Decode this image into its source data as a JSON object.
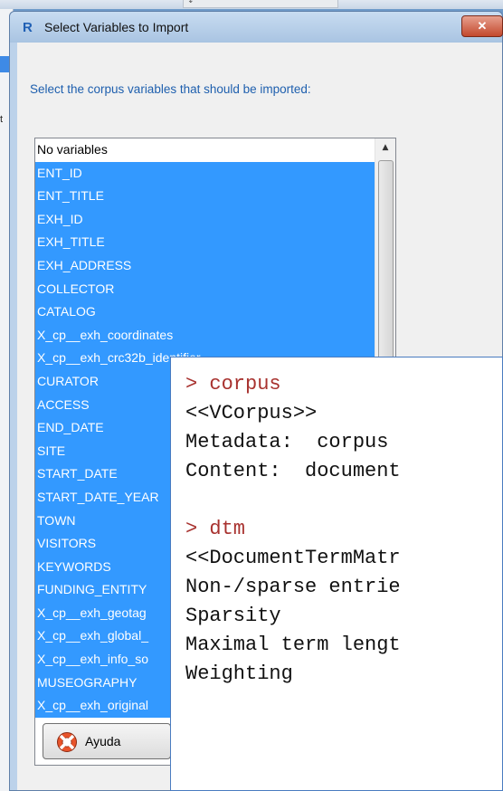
{
  "background": {
    "side_text": "t",
    "handle_text": "↓"
  },
  "dialog": {
    "app_icon_text": "R",
    "title": "Select Variables to Import",
    "close_symbol": "✕",
    "instruction": "Select the corpus variables that should be imported:",
    "list_items": [
      {
        "label": "No variables",
        "selected": false
      },
      {
        "label": "ENT_ID",
        "selected": true
      },
      {
        "label": "ENT_TITLE",
        "selected": true
      },
      {
        "label": "EXH_ID",
        "selected": true
      },
      {
        "label": "EXH_TITLE",
        "selected": true
      },
      {
        "label": "EXH_ADDRESS",
        "selected": true
      },
      {
        "label": "COLLECTOR",
        "selected": true
      },
      {
        "label": "CATALOG",
        "selected": true
      },
      {
        "label": "X_cp__exh_coordinates",
        "selected": true
      },
      {
        "label": "X_cp__exh_crc32b_identifier",
        "selected": true
      },
      {
        "label": "CURATOR",
        "selected": true
      },
      {
        "label": "ACCESS",
        "selected": true
      },
      {
        "label": "END_DATE",
        "selected": true
      },
      {
        "label": "SITE",
        "selected": true
      },
      {
        "label": "START_DATE",
        "selected": true
      },
      {
        "label": "START_DATE_YEAR",
        "selected": true
      },
      {
        "label": "TOWN",
        "selected": true
      },
      {
        "label": "VISITORS",
        "selected": true
      },
      {
        "label": "KEYWORDS",
        "selected": true
      },
      {
        "label": "FUNDING_ENTITY",
        "selected": true
      },
      {
        "label": "X_cp__exh_geotag",
        "selected": true
      },
      {
        "label": "X_cp__exh_global_",
        "selected": true
      },
      {
        "label": "X_cp__exh_info_so",
        "selected": true
      },
      {
        "label": "MUSEOGRAPHY",
        "selected": true
      },
      {
        "label": "X_cp__exh_original",
        "selected": true
      }
    ],
    "scroll_up_symbol": "▲",
    "help_button_label": "Ayuda"
  },
  "console": {
    "lines": [
      {
        "text": "> corpus",
        "kind": "cmd"
      },
      {
        "text": "<<VCorpus>>",
        "kind": "out"
      },
      {
        "text": "Metadata:  corpus",
        "kind": "out"
      },
      {
        "text": "Content:  document",
        "kind": "out"
      },
      {
        "text": "",
        "kind": "out"
      },
      {
        "text": "> dtm",
        "kind": "cmd"
      },
      {
        "text": "<<DocumentTermMatr",
        "kind": "out"
      },
      {
        "text": "Non-/sparse entrie",
        "kind": "out"
      },
      {
        "text": "Sparsity",
        "kind": "out"
      },
      {
        "text": "Maximal term lengt",
        "kind": "out"
      },
      {
        "text": "Weighting",
        "kind": "out"
      }
    ]
  },
  "colors": {
    "selection": "#3399ff",
    "instruction_text": "#1e5fae",
    "console_command": "#a8322f"
  }
}
